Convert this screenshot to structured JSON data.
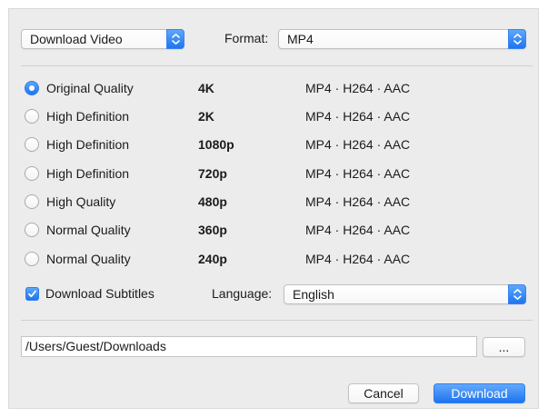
{
  "header": {
    "mode_select_value": "Download Video",
    "format_label": "Format:",
    "format_select_value": "MP4"
  },
  "qualities": [
    {
      "name": "Original Quality",
      "resolution": "4K",
      "format": "MP4 · H264 · AAC",
      "selected": true
    },
    {
      "name": "High Definition",
      "resolution": "2K",
      "format": "MP4 · H264 · AAC",
      "selected": false
    },
    {
      "name": "High Definition",
      "resolution": "1080p",
      "format": "MP4 · H264 · AAC",
      "selected": false
    },
    {
      "name": "High Definition",
      "resolution": "720p",
      "format": "MP4 · H264 · AAC",
      "selected": false
    },
    {
      "name": "High Quality",
      "resolution": "480p",
      "format": "MP4 · H264 · AAC",
      "selected": false
    },
    {
      "name": "Normal Quality",
      "resolution": "360p",
      "format": "MP4 · H264 · AAC",
      "selected": false
    },
    {
      "name": "Normal Quality",
      "resolution": "240p",
      "format": "MP4 · H264 · AAC",
      "selected": false
    }
  ],
  "subtitles": {
    "checkbox_label": "Download Subtitles",
    "checked": true,
    "language_label": "Language:",
    "language_value": "English"
  },
  "destination": {
    "path": "/Users/Guest/Downloads",
    "browse_label": "..."
  },
  "actions": {
    "cancel_label": "Cancel",
    "download_label": "Download"
  },
  "colors": {
    "accent": "#1d75f0",
    "dialog_bg": "#ececec"
  }
}
